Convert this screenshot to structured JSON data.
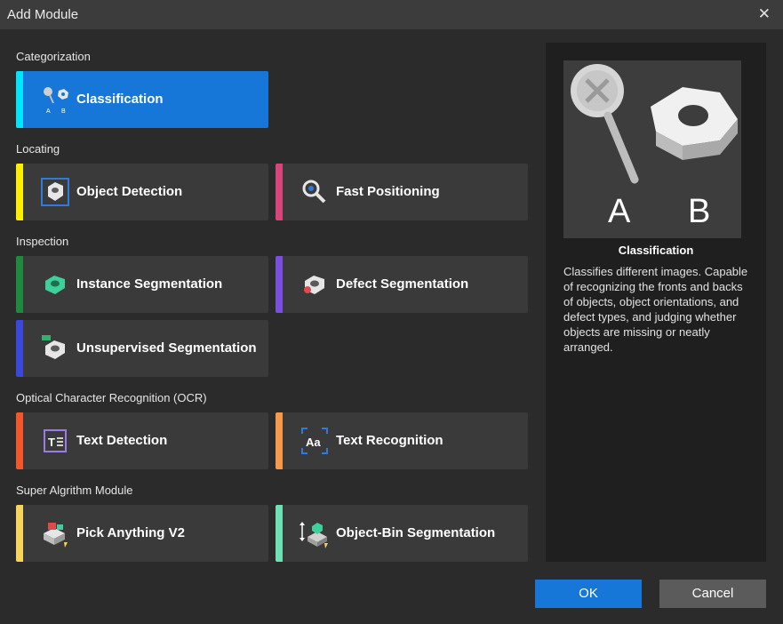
{
  "window": {
    "title": "Add Module",
    "close_glyph": "✕"
  },
  "sections": [
    {
      "label": "Categorization"
    },
    {
      "label": "Locating"
    },
    {
      "label": "Inspection"
    },
    {
      "label": "Optical Character Recognition (OCR)"
    },
    {
      "label": "Super Algrithm Module"
    }
  ],
  "modules": [
    {
      "label": "Classification",
      "icon": "classification-icon",
      "accent": "#00e5ff",
      "selected": true
    },
    {
      "label": "Object Detection",
      "icon": "object-detection-icon",
      "accent": "#ffee00",
      "selected": false
    },
    {
      "label": "Fast Positioning",
      "icon": "fast-positioning-icon",
      "accent": "#d7467a",
      "selected": false
    },
    {
      "label": "Instance Segmentation",
      "icon": "instance-segmentation-icon",
      "accent": "#1f8a3e",
      "selected": false
    },
    {
      "label": "Defect Segmentation",
      "icon": "defect-segmentation-icon",
      "accent": "#7a4fe0",
      "selected": false
    },
    {
      "label": "Unsupervised Segmentation",
      "icon": "unsupervised-segmentation-icon",
      "accent": "#3b48d9",
      "selected": false
    },
    {
      "label": "Text Detection",
      "icon": "text-detection-icon",
      "accent": "#f2562a",
      "selected": false
    },
    {
      "label": "Text Recognition",
      "icon": "text-recognition-icon",
      "accent": "#f59a4a",
      "selected": false
    },
    {
      "label": "Pick Anything V2",
      "icon": "pick-anything-icon",
      "accent": "#f7d45c",
      "selected": false
    },
    {
      "label": "Object-Bin Segmentation",
      "icon": "object-bin-segmentation-icon",
      "accent": "#6ee0b4",
      "selected": false
    }
  ],
  "preview": {
    "title": "Classification",
    "image_labels": [
      "A",
      "B"
    ],
    "description": "Classifies different images. Capable of recognizing the fronts and backs of objects, object orientations, and defect types, and judging whether objects are missing or neatly arranged."
  },
  "buttons": {
    "ok": "OK",
    "cancel": "Cancel"
  },
  "colors": {
    "accent_blue": "#1677d8",
    "card_bg": "#3a3a3a",
    "dialog_bg": "#2b2b2b"
  }
}
